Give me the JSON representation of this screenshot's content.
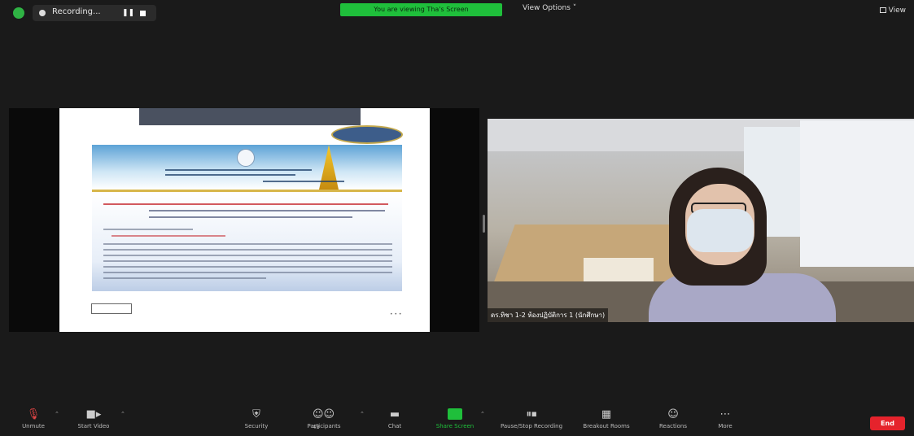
{
  "topbar": {
    "recording_label": "Recording...",
    "pause_glyph": "❚❚",
    "sharing_banner": "You are viewing Tha's Screen",
    "view_options": "View Options ˅",
    "view_button": "View"
  },
  "video": {
    "name_label": "ดร.ทิชา 1-2 ห้องปฏิบัติการ 1 (นักศึกษา)"
  },
  "toolbar": {
    "items": [
      {
        "label": "Unmute",
        "icon": "mic-muted-icon"
      },
      {
        "label": "Start Video",
        "icon": "video-camera-icon"
      },
      {
        "label": "Security",
        "icon": "shield-icon"
      },
      {
        "label": "Participants",
        "icon": "participants-icon",
        "count": "49"
      },
      {
        "label": "Chat",
        "icon": "chat-icon"
      },
      {
        "label": "Share Screen",
        "icon": "share-screen-icon"
      },
      {
        "label": "Pause/Stop Recording",
        "icon": "pause-stop-icon"
      },
      {
        "label": "Breakout Rooms",
        "icon": "breakout-rooms-icon"
      },
      {
        "label": "Reactions",
        "icon": "reactions-icon"
      },
      {
        "label": "More",
        "icon": "more-icon"
      }
    ],
    "end_label": "End"
  },
  "colors": {
    "accent_green": "#1fbf3b",
    "end_red": "#e5232c",
    "background": "#1a1a1a"
  }
}
